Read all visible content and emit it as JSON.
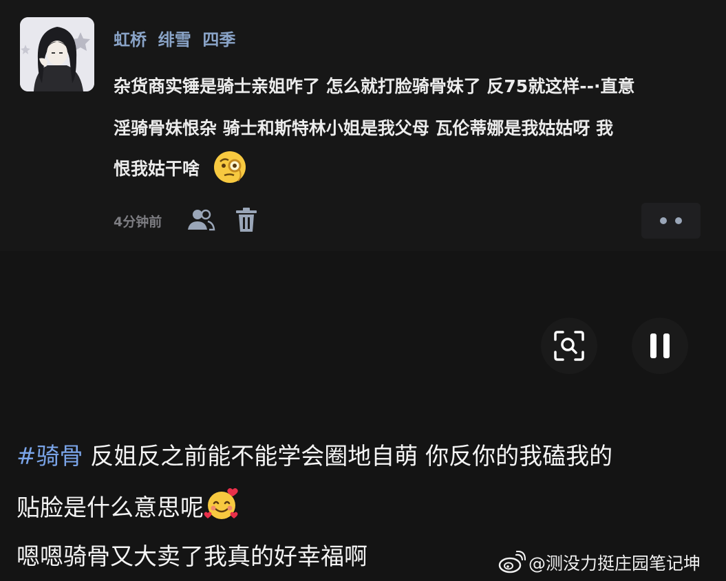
{
  "comment": {
    "username": "虹桥  绯雪  四季",
    "lines": [
      "杂货商实锤是骑士亲姐咋了  怎么就打脸骑骨妹了  反75就这样--·直意",
      "淫骑骨妹恨杂  骑士和斯特林小姐是我父母  瓦伦蒂娜是我姑姑呀  我",
      "恨我姑干啥"
    ],
    "emoji": "face-with-monocle",
    "timestamp": "4分钟前",
    "icons": {
      "mention": "users-icon",
      "delete": "trash-icon",
      "more": "more-dots-icon"
    }
  },
  "player": {
    "search_icon": "image-search-icon",
    "pause_icon": "pause-icon"
  },
  "caption": {
    "hashtag": "#骑骨",
    "line1_text": " 反姐反之前能不能学会圈地自萌 你反你的我磕我的",
    "line2_text": "贴脸是什么意思呢",
    "line2_emoji": "smiling-face-with-hearts",
    "line3_text": "嗯嗯骑骨又大卖了我真的好幸福啊"
  },
  "watermark": {
    "logo": "weibo-logo",
    "text": "@测没力挺庄园笔记坤"
  },
  "colors": {
    "background": "#141414",
    "username": "#8aa4c8",
    "hashtag": "#7aa4e8",
    "timestamp": "#7d7d82"
  }
}
